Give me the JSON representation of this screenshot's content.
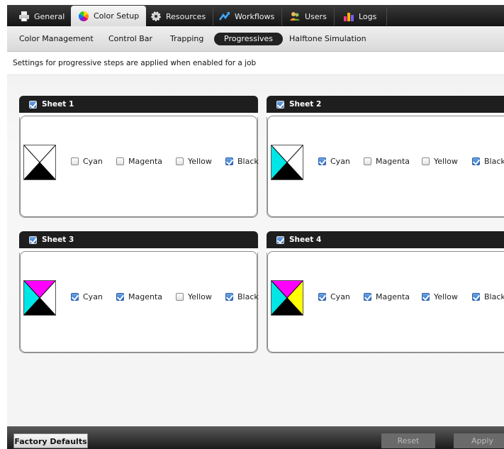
{
  "tabs": [
    {
      "label": "General",
      "icon": "printer-icon",
      "active": false
    },
    {
      "label": "Color Setup",
      "icon": "color-wheel-icon",
      "active": true
    },
    {
      "label": "Resources",
      "icon": "gear-icon",
      "active": false
    },
    {
      "label": "Workflows",
      "icon": "workflow-icon",
      "active": false
    },
    {
      "label": "Users",
      "icon": "users-icon",
      "active": false
    },
    {
      "label": "Logs",
      "icon": "logs-chart-icon",
      "active": false
    }
  ],
  "subtabs": [
    {
      "label": "Color Management",
      "active": false
    },
    {
      "label": "Control Bar",
      "active": false
    },
    {
      "label": "Trapping",
      "active": false
    },
    {
      "label": "Progressives",
      "active": true
    },
    {
      "label": "Halftone Simulation",
      "active": false
    }
  ],
  "info_text": "Settings for progressive steps are applied when enabled for a job",
  "sheets": [
    {
      "title": "Sheet 1",
      "enabled": true,
      "options": [
        {
          "label": "Cyan",
          "checked": false
        },
        {
          "label": "Magenta",
          "checked": false
        },
        {
          "label": "Yellow",
          "checked": false
        },
        {
          "label": "Black",
          "checked": true
        }
      ]
    },
    {
      "title": "Sheet 2",
      "enabled": true,
      "options": [
        {
          "label": "Cyan",
          "checked": true
        },
        {
          "label": "Magenta",
          "checked": false
        },
        {
          "label": "Yellow",
          "checked": false
        },
        {
          "label": "Black",
          "checked": true
        }
      ]
    },
    {
      "title": "Sheet 3",
      "enabled": true,
      "options": [
        {
          "label": "Cyan",
          "checked": true
        },
        {
          "label": "Magenta",
          "checked": true
        },
        {
          "label": "Yellow",
          "checked": false
        },
        {
          "label": "Black",
          "checked": true
        }
      ]
    },
    {
      "title": "Sheet 4",
      "enabled": true,
      "options": [
        {
          "label": "Cyan",
          "checked": true
        },
        {
          "label": "Magenta",
          "checked": true
        },
        {
          "label": "Yellow",
          "checked": true
        },
        {
          "label": "Black",
          "checked": true
        }
      ]
    }
  ],
  "colors": {
    "cyan": "#00e5e5",
    "magenta": "#ff00ff",
    "yellow": "#ffff00",
    "black": "#000000"
  },
  "buttons": {
    "factory_defaults": "Factory Defaults",
    "reset": "Reset",
    "apply": "Apply"
  }
}
